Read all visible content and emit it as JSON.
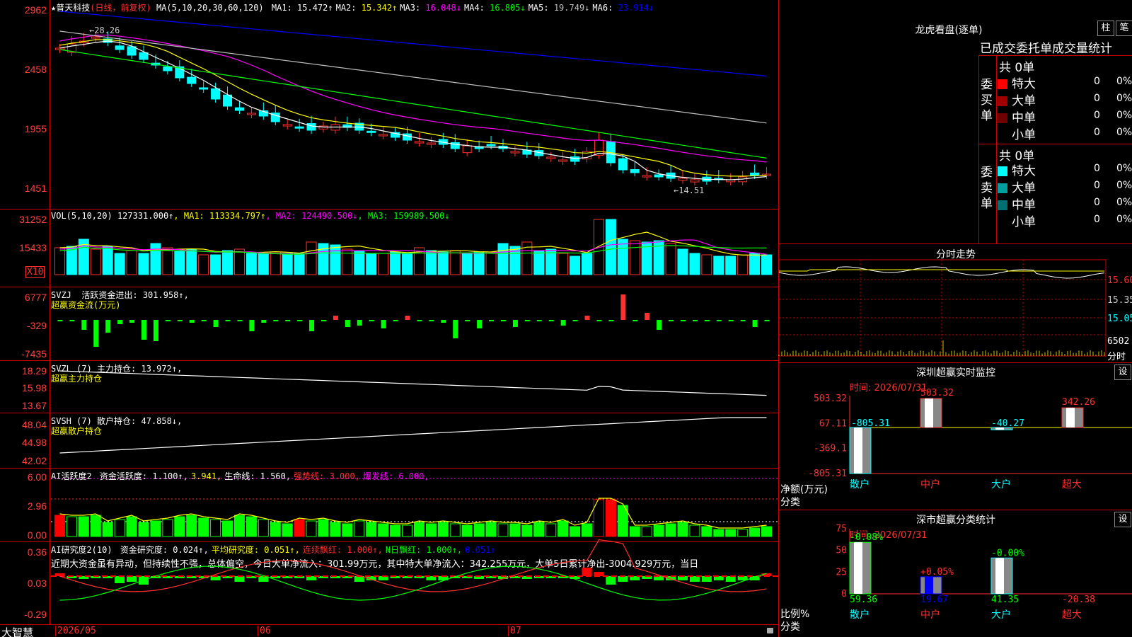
{
  "stock": {
    "star": "★",
    "name": "普天科技",
    "mode": "(日线，前复权)"
  },
  "main_chart": {
    "ma_label": "MA(5,10,20,30,60,120)",
    "ma": [
      {
        "k": "MA1:",
        "v": "15.472↑",
        "c": "#ffffff"
      },
      {
        "k": "MA2:",
        "v": "15.342↑",
        "c": "#ffff00"
      },
      {
        "k": "MA3:",
        "v": "16.048↓",
        "c": "#ff00ff"
      },
      {
        "k": "MA4:",
        "v": "16.805↓",
        "c": "#00ff00"
      },
      {
        "k": "MA5:",
        "v": "19.749↓",
        "c": "#c0c0c0"
      },
      {
        "k": "MA6:",
        "v": "23.914↓",
        "c": "#0000ff"
      }
    ],
    "y_labels": [
      "2962",
      "2458",
      "1955",
      "1451"
    ],
    "high_note": "←28.26",
    "low_note": "←14.51"
  },
  "vol": {
    "label": "VOL(5,10,20)",
    "value": "127331.000↑",
    "ma": [
      {
        "k": "MA1:",
        "v": "113334.797↑",
        "c": "#ffff00"
      },
      {
        "k": "MA2:",
        "v": "124490.500↓",
        "c": "#ff00ff"
      },
      {
        "k": "MA3:",
        "v": "159989.500↓",
        "c": "#00ff00"
      }
    ],
    "y_labels": [
      "31252",
      "15433"
    ],
    "unit": "X10"
  },
  "svzj": {
    "label": "SVZJ",
    "desc": "活跃资金进出:",
    "value": "301.958↑,",
    "sub": "超赢资金流(万元)",
    "y_labels": [
      "6777",
      "-329",
      "-7435"
    ]
  },
  "svzl": {
    "label": "SVZL (7)",
    "desc": "主力持仓:",
    "value": "13.972↑,",
    "sub": "超赢主力持仓",
    "y_labels": [
      "18.29",
      "15.98",
      "13.67"
    ]
  },
  "svsh": {
    "label": "SVSH (7)",
    "desc": "散户持仓:",
    "value": "47.858↓,",
    "sub": "超赢散户持仓",
    "y_labels": [
      "48.04",
      "44.98",
      "42.02"
    ]
  },
  "ai_active": {
    "label": "AI活跃度2",
    "parts": [
      {
        "t": "资金活跃度: 1.100↑,",
        "c": "#ffffff"
      },
      {
        "t": "3.941,",
        "c": "#ffff00"
      },
      {
        "t": "生命线: 1.560,",
        "c": "#ffffff"
      },
      {
        "t": "强势线: 3.000,",
        "c": "#ff3030"
      },
      {
        "t": "爆发线: 6.000,",
        "c": "#ff00ff"
      }
    ],
    "y_labels": [
      "6.00",
      "2.96",
      "0.00"
    ]
  },
  "ai_research": {
    "label": "AI研究度2(10)",
    "parts": [
      {
        "t": "资金研究度: 0.024↑,",
        "c": "#ffffff"
      },
      {
        "t": "平均研究度: 0.051↑,",
        "c": "#ffff00"
      },
      {
        "t": "连续飘红: 1.000↑,",
        "c": "#ff3030"
      },
      {
        "t": "N日飘红: 1.000↑,",
        "c": "#00ff00"
      },
      {
        "t": "0.051↑",
        "c": "#0000ff"
      }
    ],
    "comment": "近期大资金虽有异动，但持续性不强，总体偏空，今日大单净流入：301.99万元，其中特大单净流入：342.255万元，大单5日累计净出-3004.929万元，当日",
    "y_labels": [
      "0.36",
      "0.03",
      "-0.29"
    ]
  },
  "bottom": {
    "brand": "大智慧",
    "dates": [
      "2026/05",
      "06",
      "07"
    ]
  },
  "right": {
    "dragon_title": "龙虎看盘(逐单)",
    "btn_zhu": "柱",
    "btn_bi": "笔",
    "stat_title": "已成交委托单成交量统计",
    "buy_side": {
      "label": "委买单",
      "count": "共 0单",
      "rows": [
        {
          "n": "特大",
          "v": "0",
          "p": "0%",
          "c": "#ff0000"
        },
        {
          "n": "大单",
          "v": "0",
          "p": "0%",
          "c": "#a00000"
        },
        {
          "n": "中单",
          "v": "0",
          "p": "0%",
          "c": "#700000"
        },
        {
          "n": "小单",
          "v": "0",
          "p": "0%",
          "c": "#000000"
        }
      ]
    },
    "sell_side": {
      "label": "委卖单",
      "count": "共 0单",
      "rows": [
        {
          "n": "特大",
          "v": "0",
          "p": "0%",
          "c": "#00ffff"
        },
        {
          "n": "大单",
          "v": "0",
          "p": "0%",
          "c": "#00a0a0"
        },
        {
          "n": "中单",
          "v": "0",
          "p": "0%",
          "c": "#007070"
        },
        {
          "n": "小单",
          "v": "0",
          "p": "0%",
          "c": "#000000"
        }
      ]
    },
    "intraday": {
      "title": "分时走势",
      "y_labels": [
        "15.60",
        "15.35",
        "15.05",
        "6502",
        "分时"
      ]
    },
    "monitor": {
      "title": "深圳超赢实时监控",
      "btn": "设",
      "time": "时间: 2026/07/31",
      "unit": "净额(万元)",
      "cat_label": "分类",
      "y_labels": [
        "503.32",
        "67.11",
        "-369.1",
        "-805.31"
      ],
      "categories": [
        "散户",
        "中户",
        "大户",
        "超大"
      ],
      "values": [
        -805.31,
        503.32,
        -40.27,
        342.26
      ],
      "value_labels": [
        "-805.31",
        "503.32",
        "-40.27",
        "342.26"
      ]
    },
    "classify": {
      "title": "深市超赢分类统计",
      "btn": "设",
      "time": "时间: 2026/07/31",
      "unit": "比例%",
      "cat_label": "分类",
      "y_labels": [
        "75",
        "50",
        "25",
        "0"
      ],
      "categories": [
        "散户",
        "中户",
        "大户",
        "超大"
      ],
      "values": [
        59.36,
        19.67,
        41.35,
        -20.38
      ],
      "value_labels": [
        "59.36",
        "19.67",
        "41.35",
        "-20.38"
      ],
      "changes": [
        "-0.08%",
        "+0.05%",
        "-0.00%",
        ""
      ]
    }
  }
}
